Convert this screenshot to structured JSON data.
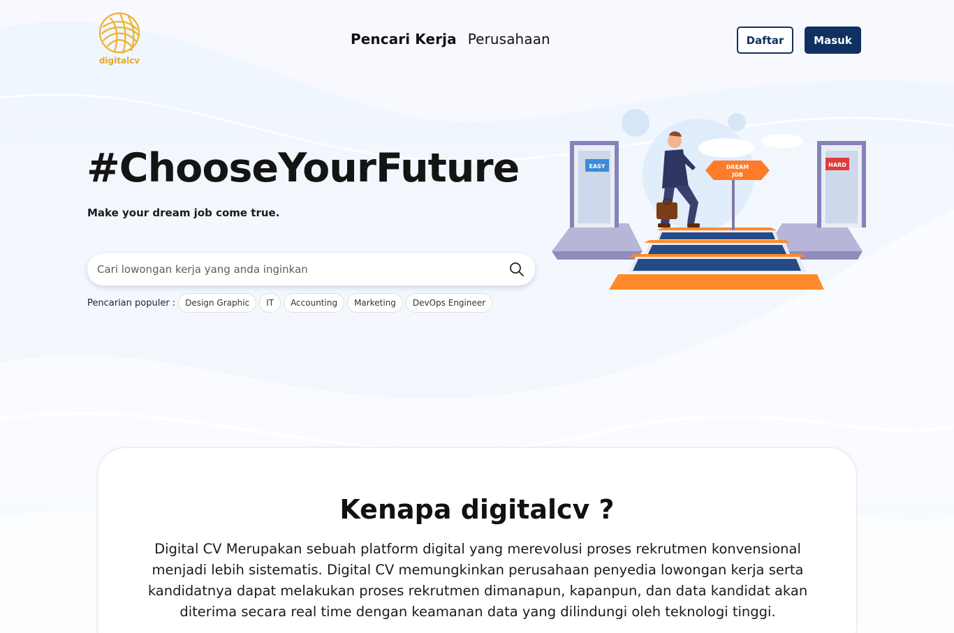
{
  "brand": {
    "name": "digitalcv",
    "accent": "#e9a826"
  },
  "nav": {
    "items": [
      {
        "label": "Pencari Kerja",
        "active": true
      },
      {
        "label": "Perusahaan",
        "active": false
      }
    ]
  },
  "auth": {
    "register_label": "Daftar",
    "login_label": "Masuk",
    "primary_color": "#0f3061"
  },
  "hero": {
    "title": "#ChooseYourFuture",
    "subtitle": "Make your dream job come true.",
    "search_placeholder": "Cari lowongan kerja yang anda inginkan",
    "popular_label": "Pencarian populer :",
    "popular_tags": [
      "Design Graphic",
      "IT",
      "Accounting",
      "Marketing",
      "DevOps Engineer"
    ],
    "illustration": {
      "left_door_sign": "EASY",
      "right_door_sign": "HARD",
      "signpost_line1": "DREAM",
      "signpost_line2": "JOB"
    }
  },
  "about": {
    "title": "Kenapa digitalcv ?",
    "body": "Digital CV Merupakan sebuah platform digital yang merevolusi proses rekrutmen konvensional menjadi lebih sistematis. Digital CV memungkinkan perusahaan penyedia lowongan kerja serta kandidatnya dapat melakukan proses rekrutmen dimanapun, kapanpun, dan data kandidat akan diterima secara real time dengan keamanan data yang dilindungi oleh teknologi tinggi."
  }
}
